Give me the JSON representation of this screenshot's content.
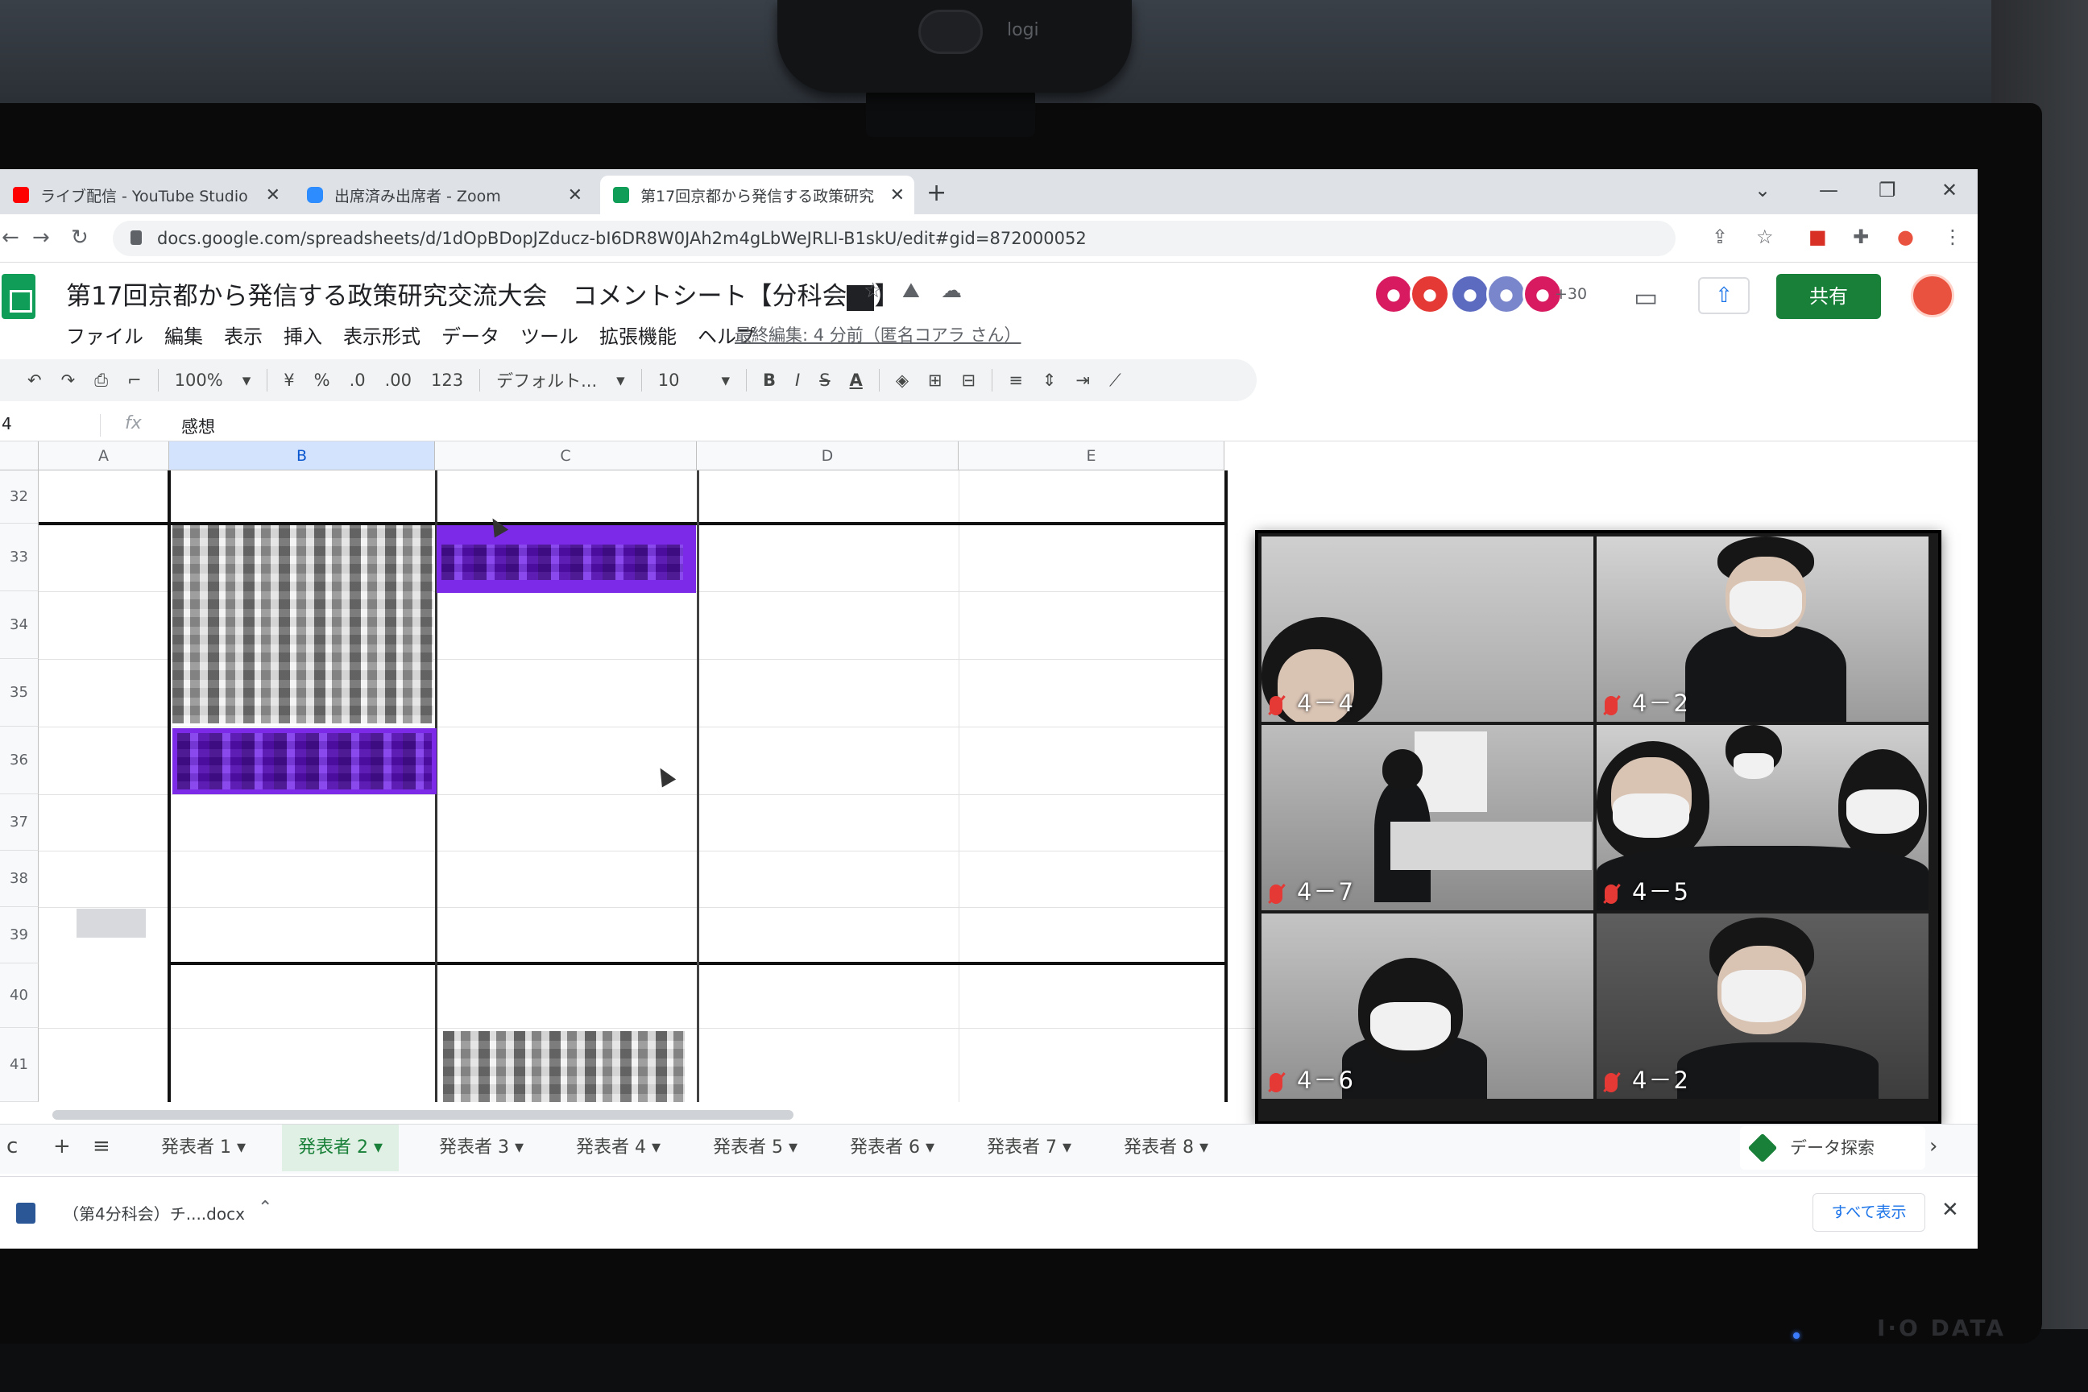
{
  "browser": {
    "tabs": [
      {
        "label": "ライブ配信 - YouTube Studio"
      },
      {
        "label": "出席済み出席者 - Zoom"
      },
      {
        "label": "第17回京都から発信する政策研究"
      }
    ],
    "new_tab": "+",
    "url": "docs.google.com/spreadsheets/d/1dOpBDopJZducz-bI6DR8W0JAh2m4gLbWeJRLI-B1skU/edit#gid=872000052"
  },
  "doc": {
    "title": "第17回京都から発信する政策研究交流大会　コメントシート【分科会",
    "title_end": "】",
    "menu": [
      "ファイル",
      "編集",
      "表示",
      "挿入",
      "表示形式",
      "データ",
      "ツール",
      "拡張機能",
      "ヘルプ"
    ],
    "last_edit": "最終編集: 4 分前（匿名コアラ さん）",
    "avatars_more": "+30",
    "share_label": "共有"
  },
  "toolbar": {
    "zoom": "100%",
    "currency": "¥",
    "percent": "%",
    "dec_less": ".0",
    "dec_more": ".00",
    "format_more": "123",
    "font": "デフォルト...",
    "font_size": "10",
    "bold": "B",
    "italic": "I",
    "strike": "S",
    "text_color": "A"
  },
  "formula": {
    "name_box": "4",
    "value": "感想"
  },
  "grid": {
    "columns": [
      "A",
      "B",
      "C",
      "D",
      "E"
    ],
    "rows": [
      "32",
      "33",
      "34",
      "35",
      "36",
      "37",
      "38",
      "39",
      "40",
      "41"
    ]
  },
  "sheet_tabs": [
    "発表者 1",
    "発表者 2",
    "発表者 3",
    "発表者 4",
    "発表者 5",
    "発表者 6",
    "発表者 7",
    "発表者 8"
  ],
  "active_sheet": "発表者 2",
  "explore_label": "データ探索",
  "downloads": {
    "file": "（第4分科会）チ....docx",
    "show_all": "すべて表示"
  },
  "zoom_tiles": [
    "4－4",
    "4－2",
    "4－7",
    "4－5",
    "4－6",
    "4－2"
  ],
  "monitor_brand": "I·O DATA",
  "webcam_brand": "logi",
  "colors": {
    "highlight_purple": "#7c2ae8",
    "share_green": "#188038",
    "sheets_green": "#0f9d58"
  }
}
